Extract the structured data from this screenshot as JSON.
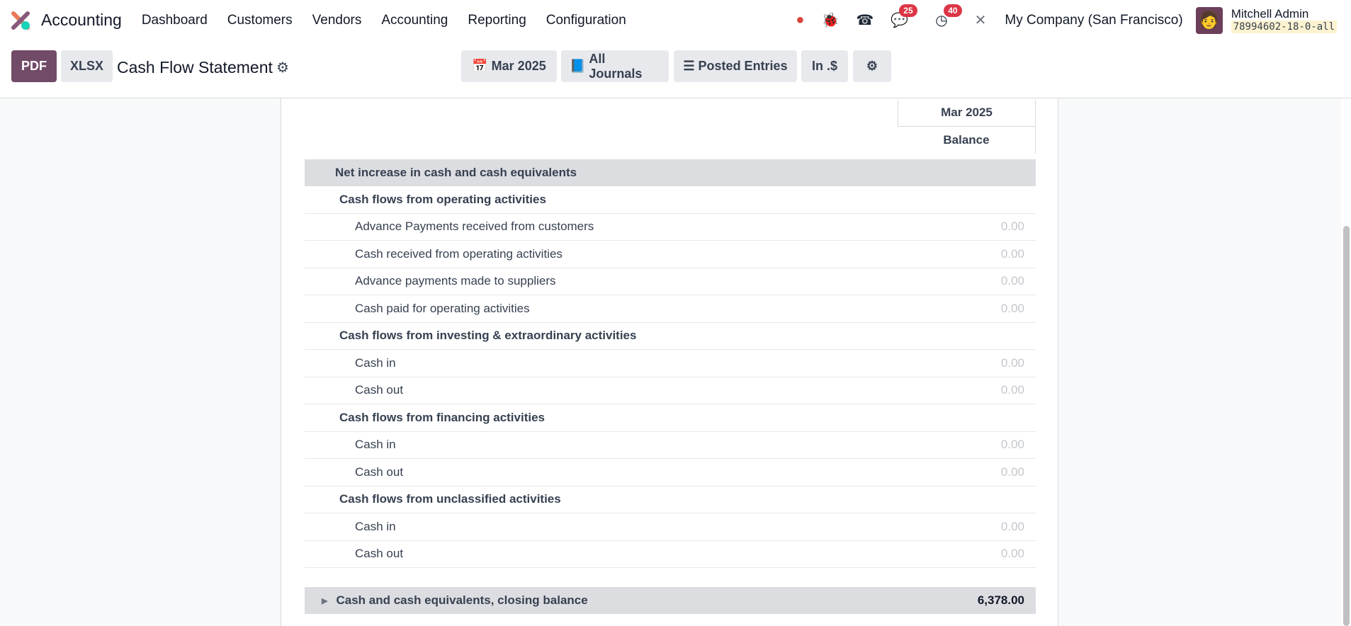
{
  "nav": {
    "app": "Accounting",
    "menu": [
      "Dashboard",
      "Customers",
      "Vendors",
      "Accounting",
      "Reporting",
      "Configuration"
    ],
    "messages_count": "25",
    "activities_count": "40",
    "company": "My Company (San Francisco)",
    "user": "Mitchell Admin",
    "database": "78994602-18-0-all"
  },
  "control": {
    "pdf": "PDF",
    "xlsx": "XLSX",
    "title": "Cash Flow Statement",
    "filters": {
      "date": "Mar 2025",
      "journals": "All Journals",
      "entries": "Posted Entries",
      "currency": "In .$"
    }
  },
  "report": {
    "column": "Mar 2025",
    "subcolumn": "Balance",
    "rows": [
      {
        "type": "top",
        "label": "Net increase in cash and cash equivalents",
        "value": ""
      },
      {
        "type": "sec",
        "label": "Cash flows from operating activities",
        "value": ""
      },
      {
        "type": "item",
        "label": "Advance Payments received from customers",
        "value": "0.00"
      },
      {
        "type": "item",
        "label": "Cash received from operating activities",
        "value": "0.00"
      },
      {
        "type": "item",
        "label": "Advance payments made to suppliers",
        "value": "0.00"
      },
      {
        "type": "item",
        "label": "Cash paid for operating activities",
        "value": "0.00"
      },
      {
        "type": "sec",
        "label": "Cash flows from investing & extraordinary activities",
        "value": ""
      },
      {
        "type": "item",
        "label": "Cash in",
        "value": "0.00"
      },
      {
        "type": "item",
        "label": "Cash out",
        "value": "0.00"
      },
      {
        "type": "sec",
        "label": "Cash flows from financing activities",
        "value": ""
      },
      {
        "type": "item",
        "label": "Cash in",
        "value": "0.00"
      },
      {
        "type": "item",
        "label": "Cash out",
        "value": "0.00"
      },
      {
        "type": "sec",
        "label": "Cash flows from unclassified activities",
        "value": ""
      },
      {
        "type": "item",
        "label": "Cash in",
        "value": "0.00"
      },
      {
        "type": "item",
        "label": "Cash out",
        "value": "0.00"
      }
    ],
    "closing": {
      "label": "Cash and cash equivalents, closing balance",
      "value": "6,378.00"
    }
  }
}
